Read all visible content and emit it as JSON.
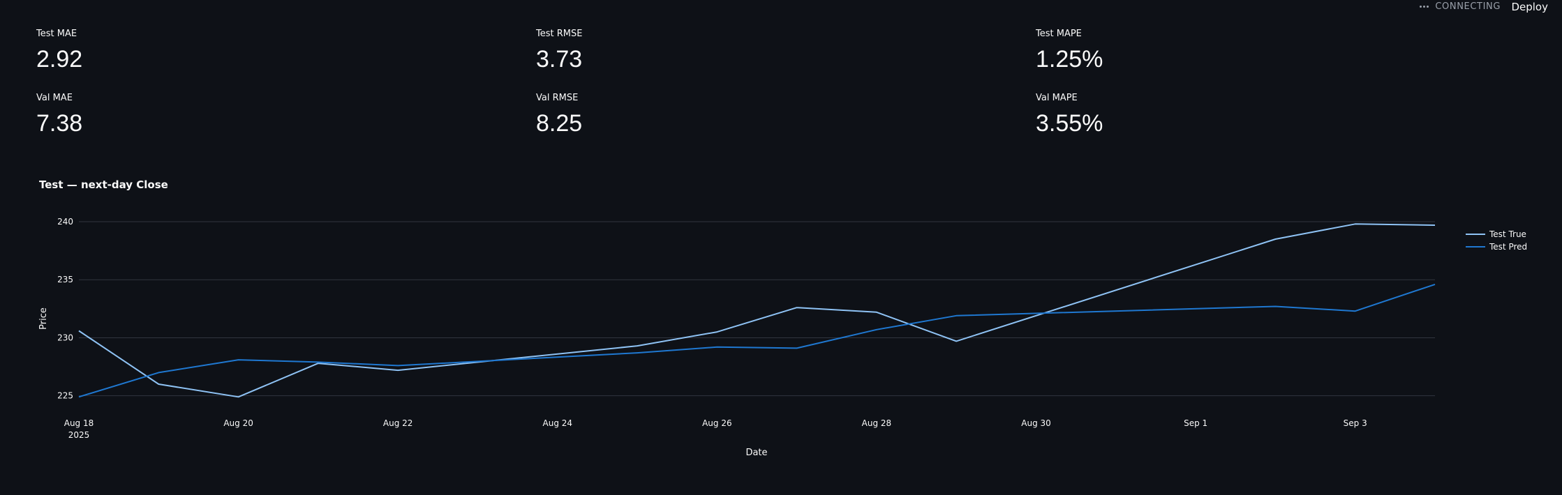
{
  "topbar": {
    "status": "CONNECTING",
    "deploy": "Deploy"
  },
  "metrics": [
    {
      "label": "Test MAE",
      "value": "2.92"
    },
    {
      "label": "Test RMSE",
      "value": "3.73"
    },
    {
      "label": "Test MAPE",
      "value": "1.25%"
    },
    {
      "label": "Val MAE",
      "value": "7.38"
    },
    {
      "label": "Val RMSE",
      "value": "8.25"
    },
    {
      "label": "Val MAPE",
      "value": "3.55%"
    }
  ],
  "chart_title": "Test — next-day Close",
  "chart_data": {
    "type": "line",
    "title": "Test — next-day Close",
    "xlabel": "Date",
    "ylabel": "Price",
    "x": [
      "2025-08-18",
      "2025-08-19",
      "2025-08-20",
      "2025-08-21",
      "2025-08-22",
      "2025-08-25",
      "2025-08-26",
      "2025-08-27",
      "2025-08-28",
      "2025-08-29",
      "2025-09-02",
      "2025-09-03",
      "2025-09-04"
    ],
    "x_ticks": [
      {
        "date": "2025-08-18",
        "label": "Aug 18",
        "sublabel": "2025"
      },
      {
        "date": "2025-08-20",
        "label": "Aug 20"
      },
      {
        "date": "2025-08-22",
        "label": "Aug 22"
      },
      {
        "date": "2025-08-24",
        "label": "Aug 24"
      },
      {
        "date": "2025-08-26",
        "label": "Aug 26"
      },
      {
        "date": "2025-08-28",
        "label": "Aug 28"
      },
      {
        "date": "2025-08-30",
        "label": "Aug 30"
      },
      {
        "date": "2025-09-01",
        "label": "Sep 1"
      },
      {
        "date": "2025-09-03",
        "label": "Sep 3"
      }
    ],
    "yticks": [
      225,
      230,
      235,
      240
    ],
    "ylim": [
      224.5,
      240
    ],
    "xlim": [
      "2025-08-18",
      "2025-09-04"
    ],
    "grid": true,
    "legend_position": "top-right",
    "series": [
      {
        "name": "Test True",
        "color": "#8fc3f5",
        "values": [
          230.6,
          226.0,
          224.9,
          227.8,
          227.2,
          229.3,
          230.5,
          232.6,
          232.2,
          229.7,
          238.5,
          239.8,
          239.7
        ]
      },
      {
        "name": "Test Pred",
        "color": "#1f78d1",
        "values": [
          224.9,
          227.0,
          228.1,
          227.9,
          227.6,
          228.7,
          229.2,
          229.1,
          230.7,
          231.9,
          232.7,
          232.3,
          234.6
        ]
      }
    ]
  }
}
